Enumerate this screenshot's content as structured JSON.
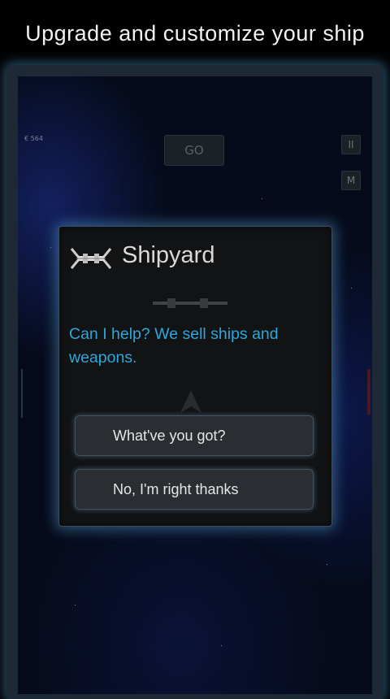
{
  "caption": "Upgrade and customize your ship",
  "hud": {
    "credits": "€ 564",
    "go_label": "GO",
    "pause_label": "II",
    "map_label": "M"
  },
  "dialog": {
    "title": "Shipyard",
    "message": "Can I help? We sell ships and weapons.",
    "choices": [
      "What've you got?",
      "No, I'm right thanks"
    ]
  }
}
